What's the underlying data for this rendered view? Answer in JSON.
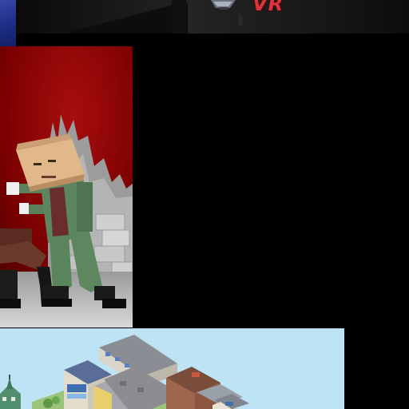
{
  "top_banner": {
    "logo_text": "VR"
  },
  "tiles": [
    {
      "id": "top-blue-thumb",
      "kind": "game-thumbnail"
    },
    {
      "id": "vr-banner",
      "kind": "game-banner"
    },
    {
      "id": "blocky-fighter",
      "kind": "game-thumbnail"
    },
    {
      "id": "isometric-city",
      "kind": "game-thumbnail"
    }
  ],
  "colors": {
    "page_background": "#000000",
    "vr_logo_red": "#e0343a",
    "fighter_backdrop_red": "#8a0000",
    "city_sky": "#b9e1f4",
    "top_thumb_blue": "#2a3a9a"
  }
}
